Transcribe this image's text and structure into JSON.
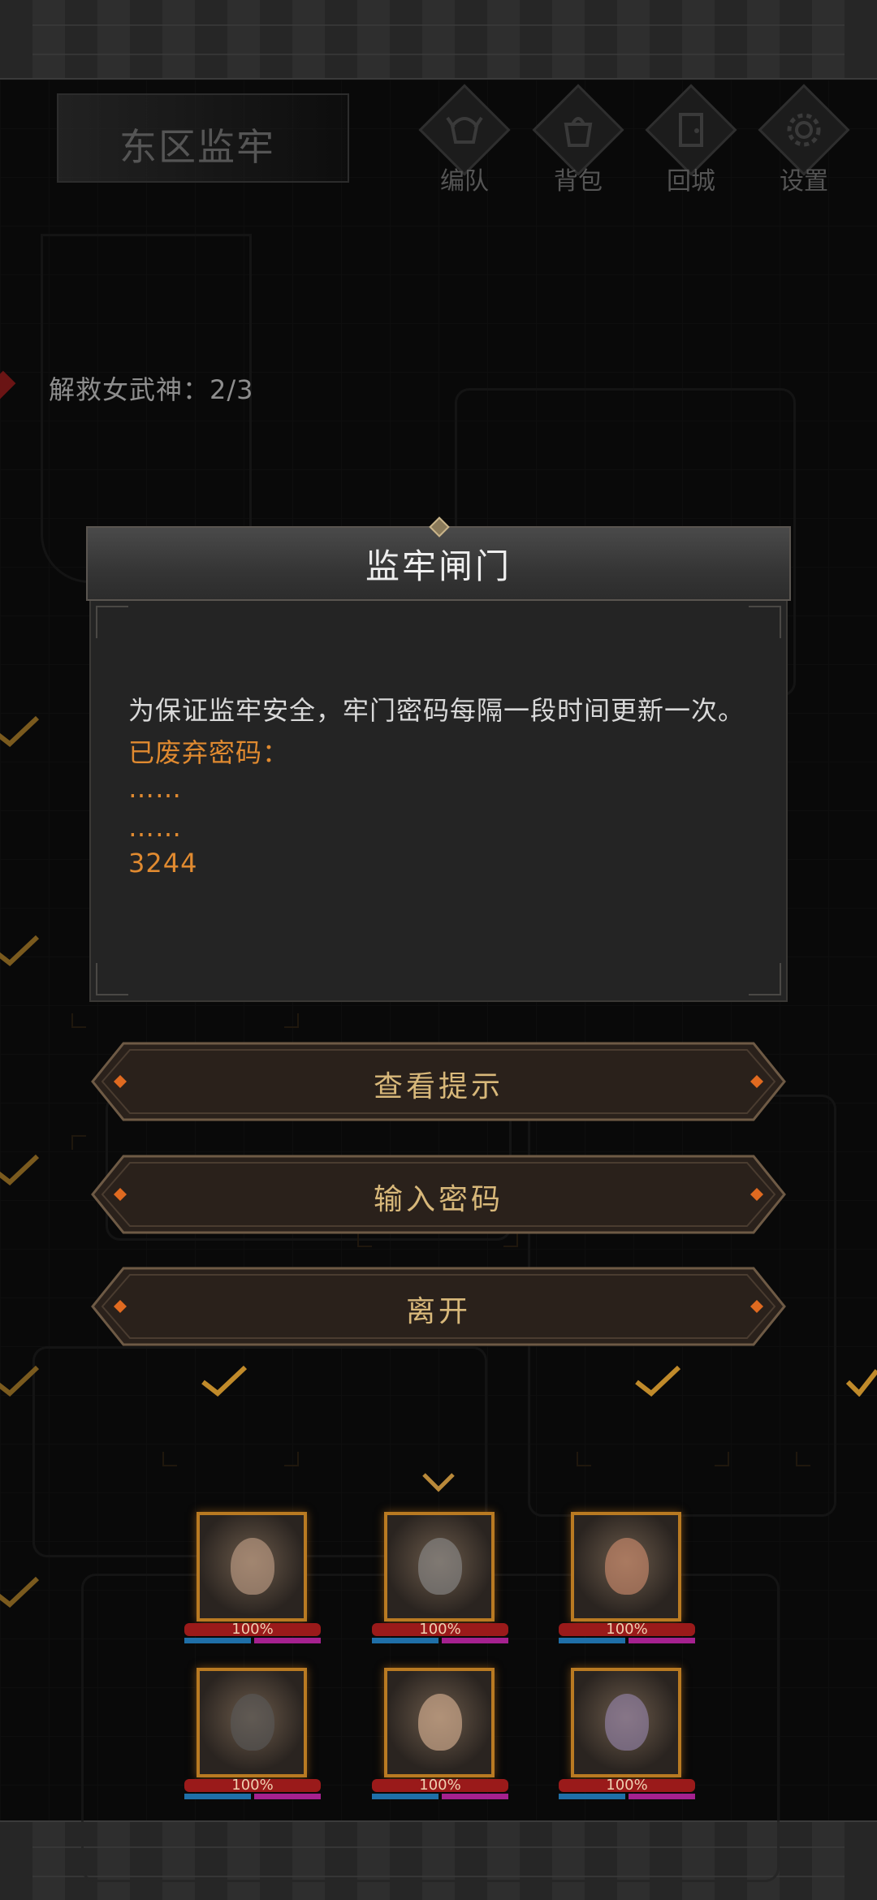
{
  "header": {
    "area_title": "东区监牢"
  },
  "menu": [
    {
      "label": "编队",
      "icon": "helmet-icon"
    },
    {
      "label": "背包",
      "icon": "bag-icon"
    },
    {
      "label": "回城",
      "icon": "door-icon"
    },
    {
      "label": "设置",
      "icon": "gear-icon"
    }
  ],
  "progress": {
    "label": "解救女武神：2/3",
    "rescued": 2,
    "total": 3
  },
  "dialog": {
    "title": "监牢闸门",
    "message": "为保证监牢安全，牢门密码每隔一段时间更新一次。",
    "discarded_label": "已废弃密码：",
    "lines": [
      "……",
      "……",
      "3244"
    ]
  },
  "buttons": {
    "hint": "查看提示",
    "enter_password": "输入密码",
    "leave": "离开"
  },
  "party": [
    {
      "hp": "100%"
    },
    {
      "hp": "100%"
    },
    {
      "hp": "100%"
    },
    {
      "hp": "100%"
    },
    {
      "hp": "100%"
    },
    {
      "hp": "100%"
    }
  ],
  "colors": {
    "accent_orange": "#e08a30",
    "button_text": "#d8b87a",
    "portrait_border": "#b97a22",
    "hp_bar": "#9a1a1a"
  }
}
